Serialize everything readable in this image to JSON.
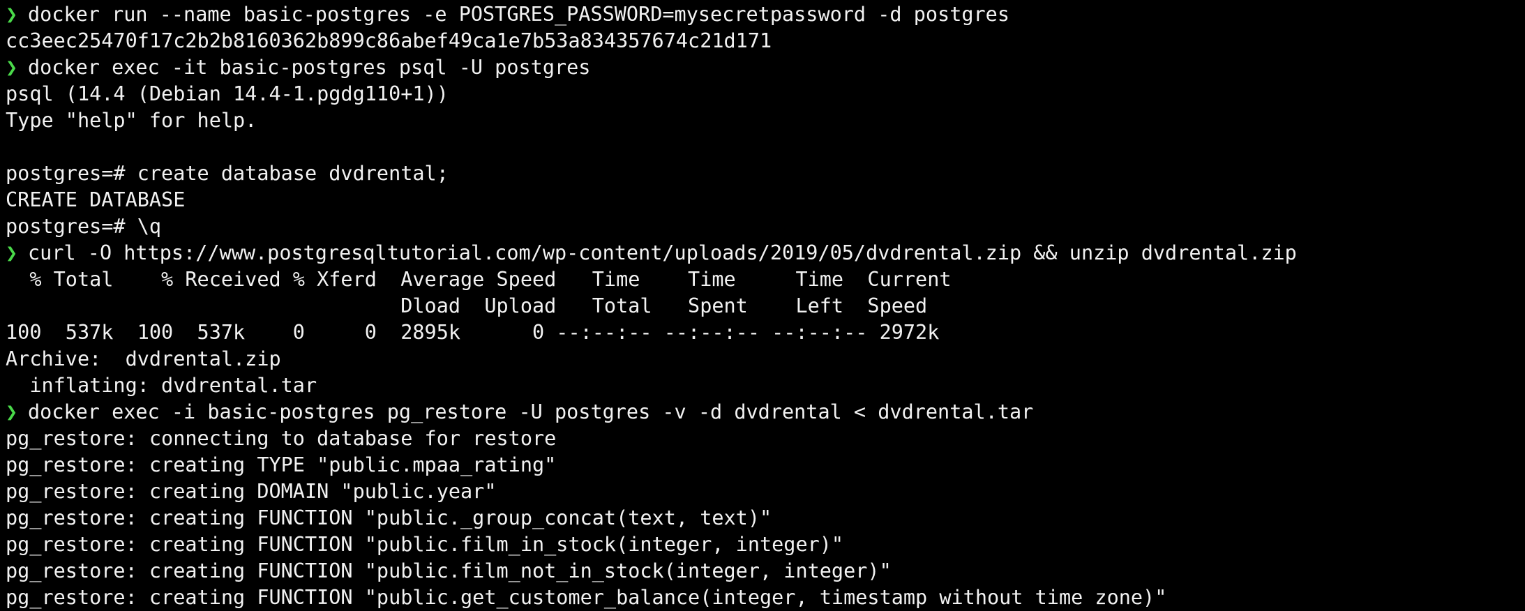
{
  "colors": {
    "background": "#000000",
    "foreground": "#f2f2f2",
    "prompt_arrow": "#4ad94a"
  },
  "prompt_icon": "chevron-right-icon",
  "prompt_symbol": "❯",
  "lines": [
    {
      "type": "command",
      "text": "docker run --name basic-postgres -e POSTGRES_PASSWORD=mysecretpassword -d postgres"
    },
    {
      "type": "output",
      "text": "cc3eec25470f17c2b2b8160362b899c86abef49ca1e7b53a834357674c21d171"
    },
    {
      "type": "command",
      "text": "docker exec -it basic-postgres psql -U postgres"
    },
    {
      "type": "output",
      "text": "psql (14.4 (Debian 14.4-1.pgdg110+1))"
    },
    {
      "type": "output",
      "text": "Type \"help\" for help."
    },
    {
      "type": "output",
      "text": ""
    },
    {
      "type": "output",
      "text": "postgres=# create database dvdrental;"
    },
    {
      "type": "output",
      "text": "CREATE DATABASE"
    },
    {
      "type": "output",
      "text": "postgres=# \\q"
    },
    {
      "type": "command",
      "text": "curl -O https://www.postgresqltutorial.com/wp-content/uploads/2019/05/dvdrental.zip && unzip dvdrental.zip"
    },
    {
      "type": "output",
      "text": "  % Total    % Received % Xferd  Average Speed   Time    Time     Time  Current"
    },
    {
      "type": "output",
      "text": "                                 Dload  Upload   Total   Spent    Left  Speed"
    },
    {
      "type": "output",
      "text": "100  537k  100  537k    0     0  2895k      0 --:--:-- --:--:-- --:--:-- 2972k"
    },
    {
      "type": "output",
      "text": "Archive:  dvdrental.zip"
    },
    {
      "type": "output",
      "text": "  inflating: dvdrental.tar"
    },
    {
      "type": "command",
      "text": "docker exec -i basic-postgres pg_restore -U postgres -v -d dvdrental < dvdrental.tar"
    },
    {
      "type": "output",
      "text": "pg_restore: connecting to database for restore"
    },
    {
      "type": "output",
      "text": "pg_restore: creating TYPE \"public.mpaa_rating\""
    },
    {
      "type": "output",
      "text": "pg_restore: creating DOMAIN \"public.year\""
    },
    {
      "type": "output",
      "text": "pg_restore: creating FUNCTION \"public._group_concat(text, text)\""
    },
    {
      "type": "output",
      "text": "pg_restore: creating FUNCTION \"public.film_in_stock(integer, integer)\""
    },
    {
      "type": "output",
      "text": "pg_restore: creating FUNCTION \"public.film_not_in_stock(integer, integer)\""
    },
    {
      "type": "output",
      "text": "pg_restore: creating FUNCTION \"public.get_customer_balance(integer, timestamp without time zone)\""
    }
  ]
}
